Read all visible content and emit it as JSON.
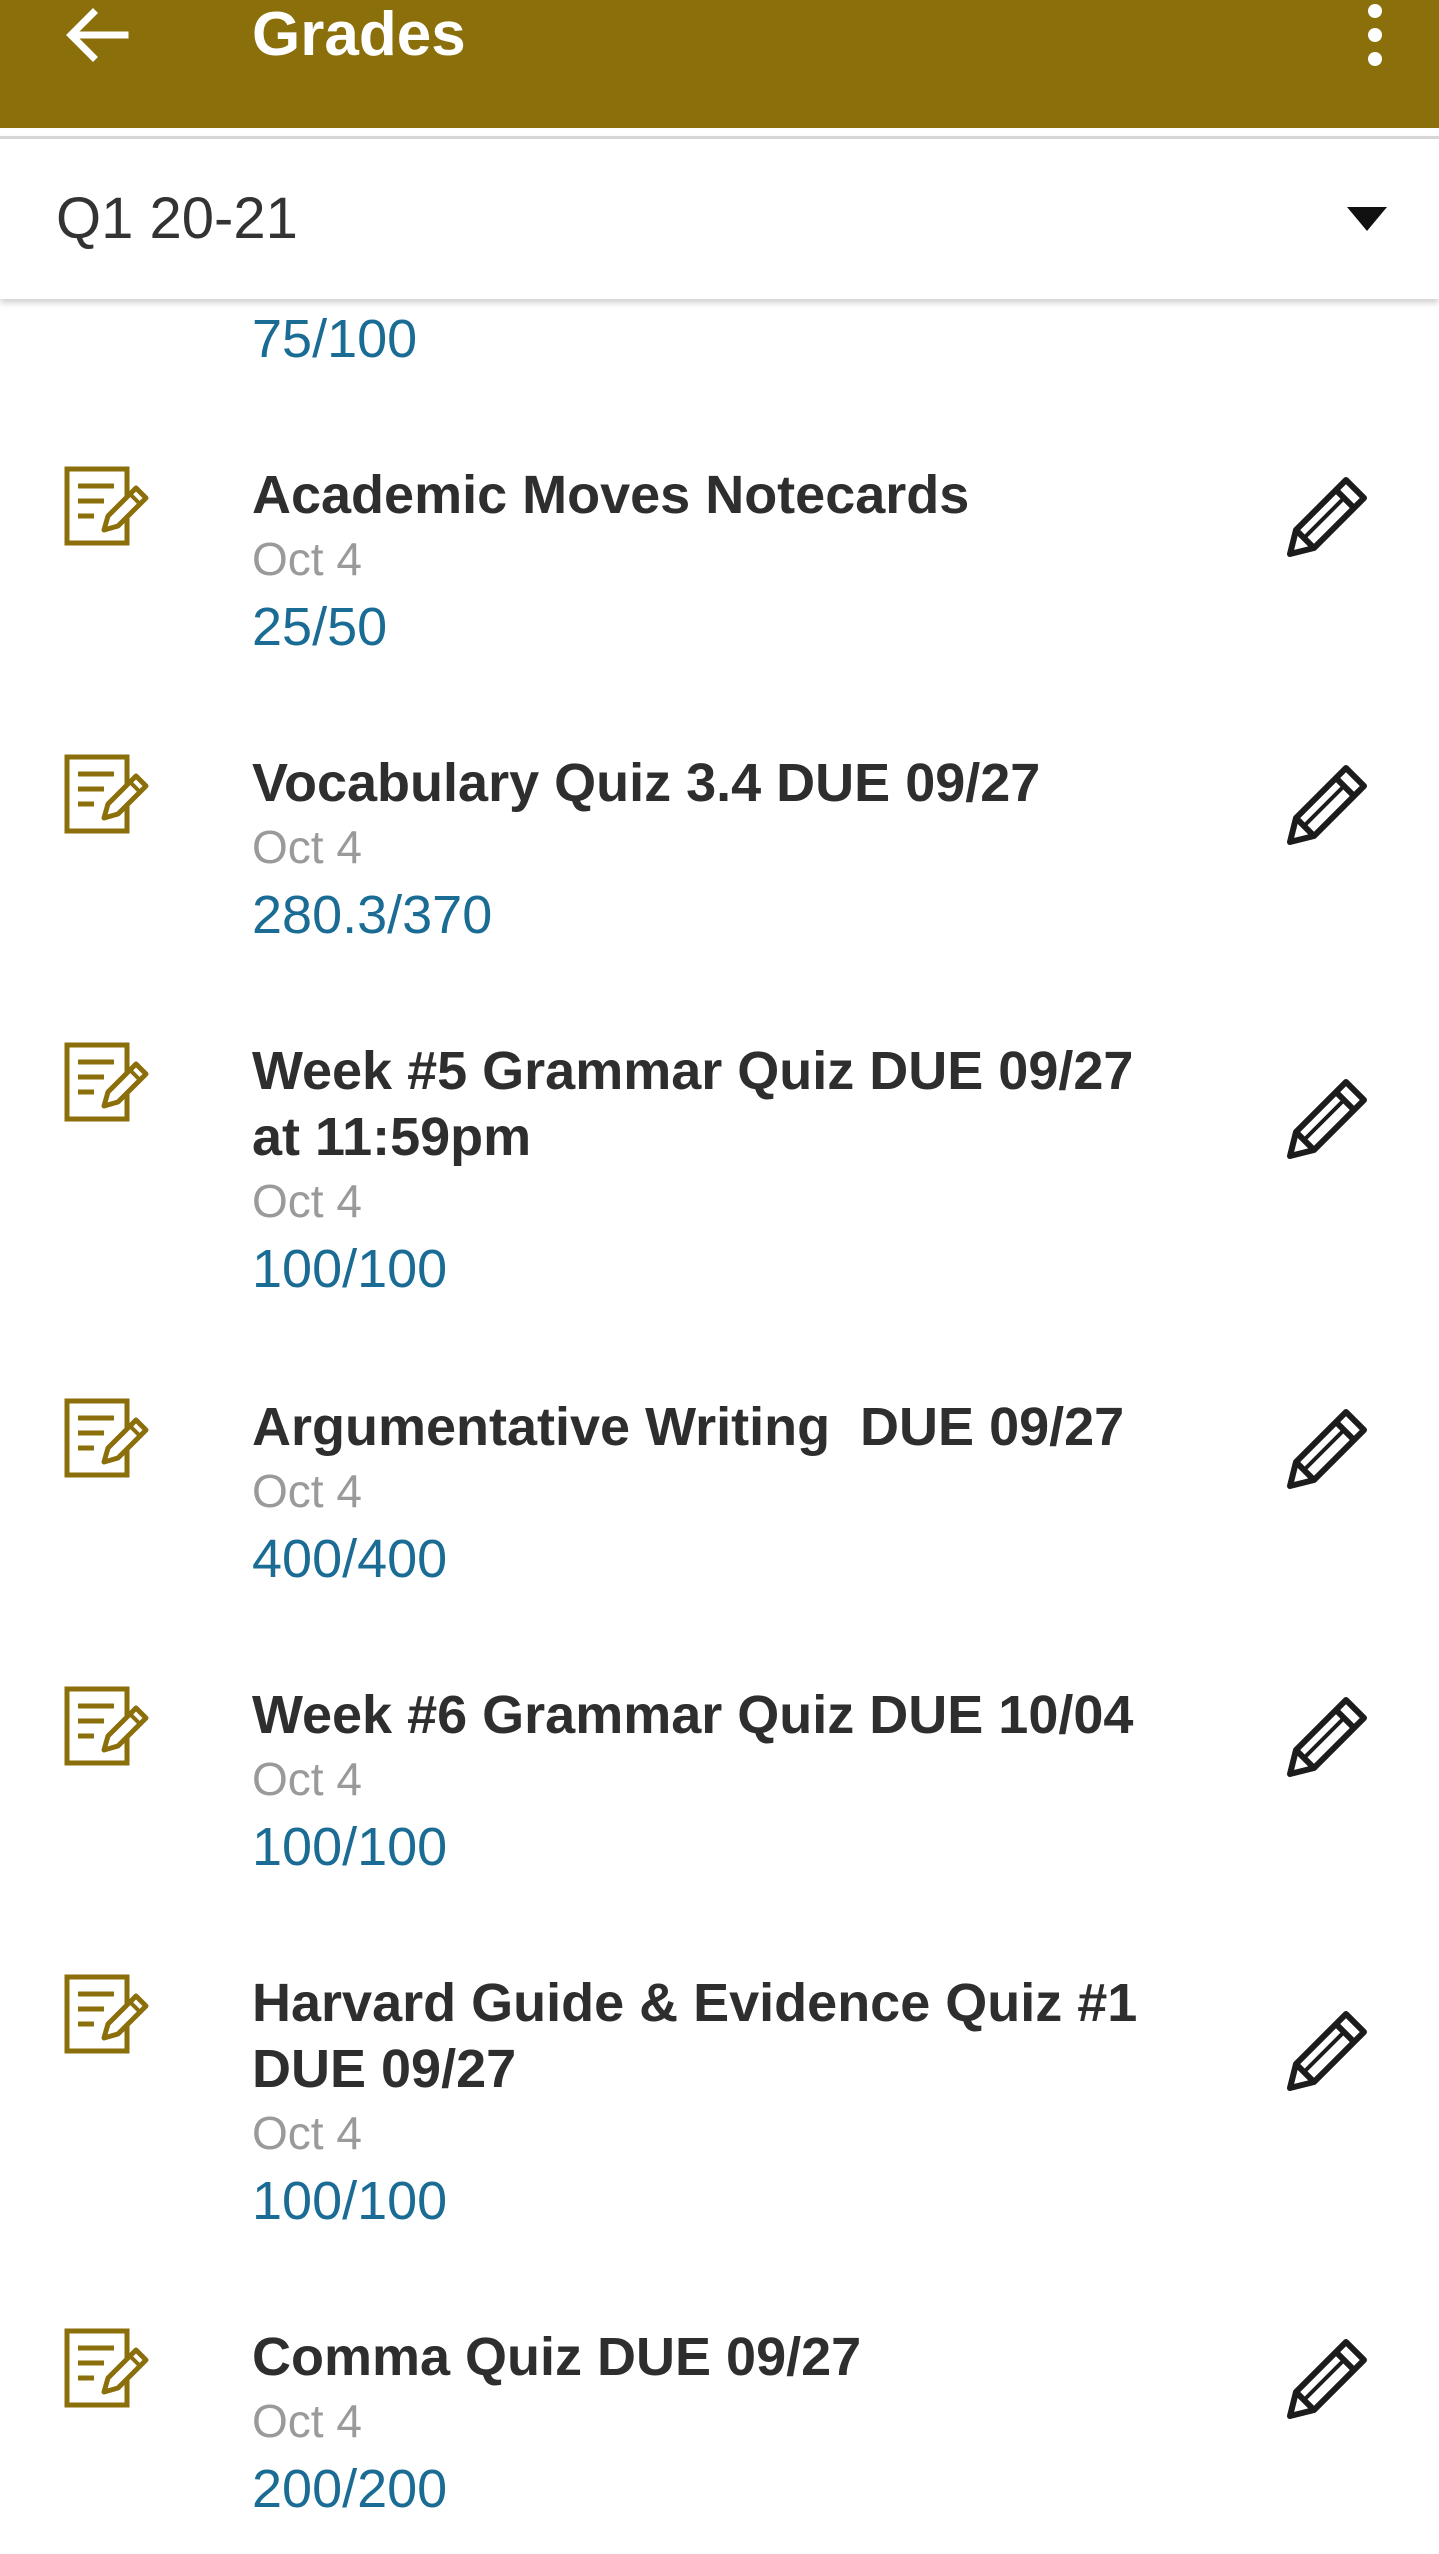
{
  "app_bar": {
    "title": "Grades",
    "back_icon": "arrow-left-icon",
    "menu_icon": "more-vertical-icon",
    "color": "#8b6f0b"
  },
  "term_selector": {
    "value": "Q1 20-21"
  },
  "partial_item": {
    "score": "75/100"
  },
  "assignments": [
    {
      "title": "Academic Moves Notecards",
      "date": "Oct 4",
      "score": "25/50"
    },
    {
      "title": "Vocabulary Quiz 3.4 DUE 09/27",
      "date": "Oct 4",
      "score": "280.3/370"
    },
    {
      "title": "Week #5 Grammar Quiz DUE 09/27\nat 11:59pm",
      "date": "Oct 4",
      "score": "100/100"
    },
    {
      "title": "Argumentative Writing  DUE 09/27",
      "date": "Oct 4",
      "score": "400/400"
    },
    {
      "title": "Week #6 Grammar Quiz DUE 10/04",
      "date": "Oct 4",
      "score": "100/100"
    },
    {
      "title": "Harvard Guide & Evidence Quiz #1\nDUE 09/27",
      "date": "Oct 4",
      "score": "100/100"
    },
    {
      "title": "Comma Quiz DUE 09/27",
      "date": "Oct 4",
      "score": "200/200"
    }
  ],
  "colors": {
    "accent": "#8b6f0b",
    "score": "#1a6c94",
    "date": "#9a9a9a",
    "title": "#2e2e2e"
  }
}
